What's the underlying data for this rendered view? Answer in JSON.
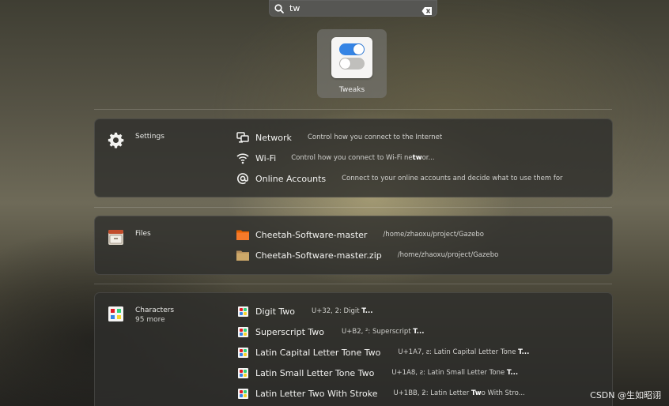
{
  "search": {
    "value": "tw"
  },
  "app_result": {
    "label": "Tweaks",
    "icon": "toggle-switches-icon"
  },
  "settings": {
    "provider": "Settings",
    "provider_icon": "gear-icon",
    "results": [
      {
        "title": "Network",
        "desc": "Control how you connect to the Internet",
        "icon": "network-wired-icon"
      },
      {
        "title": "Wi-Fi",
        "desc_pre": "Control how you connect to Wi-Fi ne",
        "desc_bold": "tw",
        "desc_post": "or...",
        "icon": "wifi-icon"
      },
      {
        "title": "Online Accounts",
        "desc": "Connect to your online accounts and decide what to use them for",
        "icon": "at-sign-icon"
      }
    ]
  },
  "files": {
    "provider": "Files",
    "provider_icon": "file-cabinet-icon",
    "results": [
      {
        "title": "Cheetah-Software-master",
        "desc": "/home/zhaoxu/project/Gazebo",
        "icon": "folder-icon",
        "color": "#e66100"
      },
      {
        "title": "Cheetah-Software-master.zip",
        "desc": "/home/zhaoxu/project/Gazebo",
        "icon": "archive-icon",
        "color": "#cda869"
      }
    ]
  },
  "characters": {
    "provider": "Characters",
    "subtitle": "95 more",
    "provider_icon": "characters-icon",
    "results": [
      {
        "title": "Digit Two",
        "desc_pre": "U+32, 2: Digit ",
        "desc_bold": "T...",
        "desc_post": ""
      },
      {
        "title": "Superscript Two",
        "desc_pre": "U+B2, ²: Superscript ",
        "desc_bold": "T...",
        "desc_post": ""
      },
      {
        "title": "Latin Capital Letter Tone Two",
        "desc_pre": "U+1A7, ƨ: Latin Capital Letter Tone ",
        "desc_bold": "T...",
        "desc_post": ""
      },
      {
        "title": "Latin Small Letter Tone Two",
        "desc_pre": "U+1A8, ƨ: Latin Small Letter Tone ",
        "desc_bold": "T...",
        "desc_post": ""
      },
      {
        "title": "Latin Letter Two With Stroke",
        "desc_pre": "U+1BB, ƻ: Latin Letter ",
        "desc_bold": "Tw",
        "desc_post": "o With Stro..."
      }
    ]
  },
  "watermark": "CSDN @生如昭诩",
  "colors": {
    "accent": "#3584e4",
    "panel": "#2e2e2c"
  }
}
